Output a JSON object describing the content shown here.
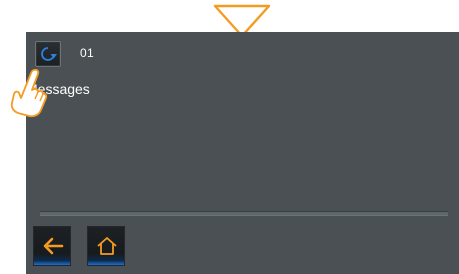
{
  "colors": {
    "accent_orange": "#f39c22",
    "accent_blue": "#2f7fe0",
    "panel_bg": "#4a5053"
  },
  "messages": {
    "count": "01",
    "title": "Messages"
  },
  "icons": {
    "top": "triangle-down-indicator-icon",
    "replay": "replay-icon",
    "back": "back-arrow-icon",
    "home": "home-icon",
    "hand": "pointing-hand-icon"
  }
}
